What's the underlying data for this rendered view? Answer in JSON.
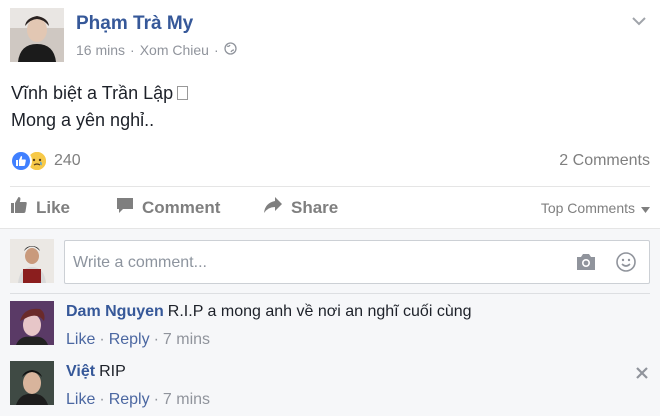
{
  "post": {
    "author": "Phạm Trà My",
    "time": "16 mins",
    "separator": "·",
    "location": "Xom Chieu",
    "audience_icon": "globe-icon",
    "menu_icon": "chevron-down-icon",
    "text_line1": "Vĩnh biệt a Trần Lập",
    "text_line2": "Mong a yên nghỉ..",
    "reactions": {
      "types": [
        "like",
        "sad"
      ],
      "count": "240"
    },
    "comments_count": "2 Comments",
    "actions": {
      "like": "Like",
      "comment": "Comment",
      "share": "Share",
      "sort": "Top Comments"
    }
  },
  "composer": {
    "placeholder": "Write a comment...",
    "camera_icon": "camera-icon",
    "emoji_icon": "smiley-icon"
  },
  "comments": [
    {
      "name": "Dam Nguyen",
      "text": "R.I.P a mong anh về nơi an nghĩ cuối cùng",
      "like": "Like",
      "reply": "Reply",
      "time": "7 mins"
    },
    {
      "name": "Việt",
      "text": "RIP",
      "like": "Like",
      "reply": "Reply",
      "time": "7 mins"
    }
  ],
  "colors": {
    "link_blue": "#365899",
    "meta_grey": "#90949c",
    "like_blue": "#4080ff",
    "sad_yellow": "#f7c948",
    "comments_bg": "#f6f7f9"
  }
}
